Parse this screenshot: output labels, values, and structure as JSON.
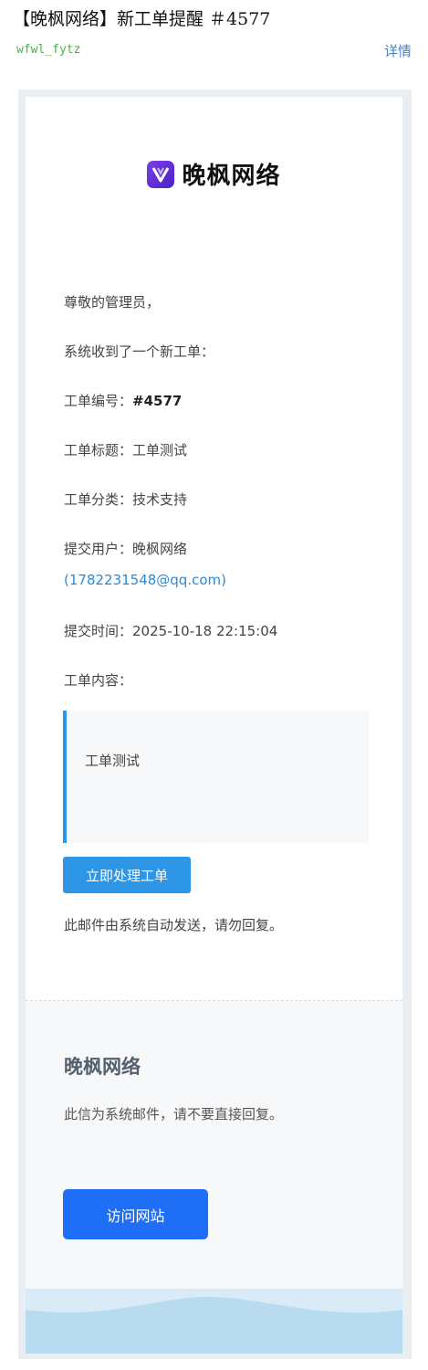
{
  "header": {
    "subject": "【晚枫网络】新工单提醒 ＃4577",
    "sender": "wfwl_fytz",
    "detail_link": "详情"
  },
  "email": {
    "logo_icon": "v-logo-icon",
    "brand_name": "晚枫网络",
    "greeting": "尊敬的管理员，",
    "intro": "系统收到了一个新工单：",
    "ticket_id_label": "工单编号：",
    "ticket_id": "#4577",
    "ticket_title_label": "工单标题：",
    "ticket_title": "工单测试",
    "category_label": "工单分类：",
    "category": "技术支持",
    "user_label": "提交用户：",
    "user_name": "晚枫网络",
    "user_email": "(1782231548@qq.com)",
    "time_label": "提交时间：",
    "time": "2025-10-18 22:15:04",
    "content_label": "工单内容：",
    "content": "工单测试",
    "process_button": "立即处理工单",
    "auto_note": "此邮件由系统自动发送，请勿回复。"
  },
  "footer": {
    "brand": "晚枫网络",
    "note": "此信为系统邮件，请不要直接回复。",
    "visit_button": "访问网站"
  },
  "colors": {
    "accent": "#2d96e6",
    "visit_button": "#1e6ff5",
    "logo": "#6a35e0",
    "sender": "#4caf50"
  }
}
